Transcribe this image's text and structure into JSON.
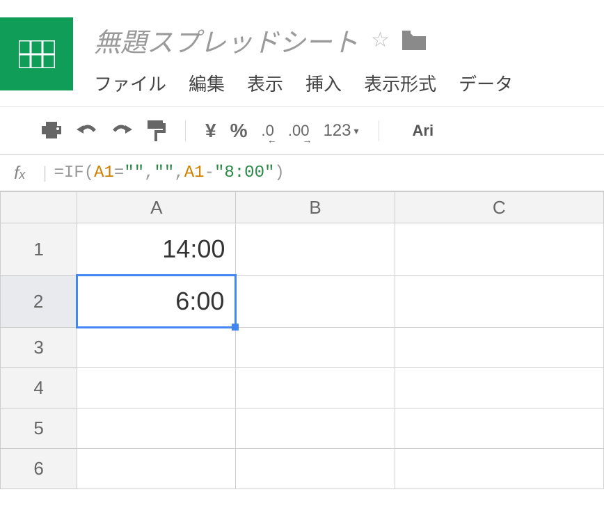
{
  "header": {
    "title": "無題スプレッドシート"
  },
  "menu": {
    "file": "ファイル",
    "edit": "編集",
    "view": "表示",
    "insert": "挿入",
    "format": "表示形式",
    "data": "データ"
  },
  "toolbar": {
    "currency": "¥",
    "percent": "%",
    "dec_decrease": ".0",
    "dec_increase": ".00",
    "num_format": "123",
    "font": "Ari"
  },
  "formula_bar": {
    "fx": "fx",
    "parts": {
      "p1": "=IF",
      "p2": "(",
      "p3": "A1",
      "p4": "=",
      "p5": "\"\"",
      "p6": ",",
      "p7": "\"\"",
      "p8": ",",
      "p9": "A1",
      "p10": "-",
      "p11": "\"8:00\"",
      "p12": ")"
    }
  },
  "columns": {
    "a": "A",
    "b": "B",
    "c": "C"
  },
  "rows": {
    "r1": "1",
    "r2": "2",
    "r3": "3",
    "r4": "4",
    "r5": "5",
    "r6": "6"
  },
  "cells": {
    "a1": "14:00",
    "a2": "6:00"
  }
}
